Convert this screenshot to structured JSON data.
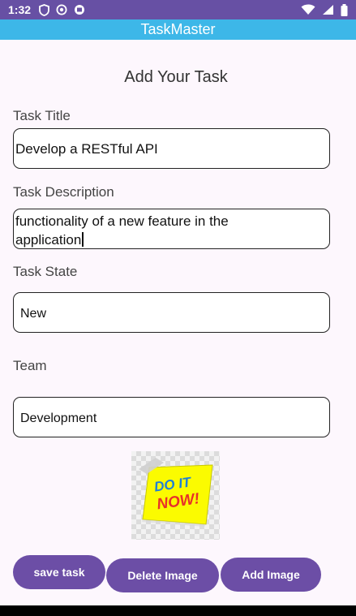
{
  "status_bar": {
    "time": "1:32",
    "left_icons": [
      "shield-icon",
      "at-icon",
      "media-icon"
    ],
    "right_icons": [
      "wifi-icon",
      "signal-icon",
      "battery-icon"
    ]
  },
  "app_bar": {
    "title": "TaskMaster"
  },
  "screen": {
    "title": "Add Your Task",
    "task_title": {
      "label": "Task Title",
      "value": "Develop a RESTful API"
    },
    "task_description": {
      "label": "Task Description",
      "line1": "functionality of a new feature in the",
      "line2": "application"
    },
    "task_state": {
      "label": "Task State",
      "value": "New"
    },
    "team": {
      "label": "Team",
      "value": "Development"
    },
    "image": {
      "name": "do-it-now-sticky-note",
      "line1": "DO IT",
      "line2": "NOW!"
    }
  },
  "buttons": {
    "save": "save task",
    "delete_image": "Delete Image",
    "add_image": "Add Image"
  },
  "colors": {
    "status_bar": "#6750a4",
    "app_bar": "#3db7e8",
    "button": "#6c4ea6",
    "background": "#fdf7fd"
  }
}
